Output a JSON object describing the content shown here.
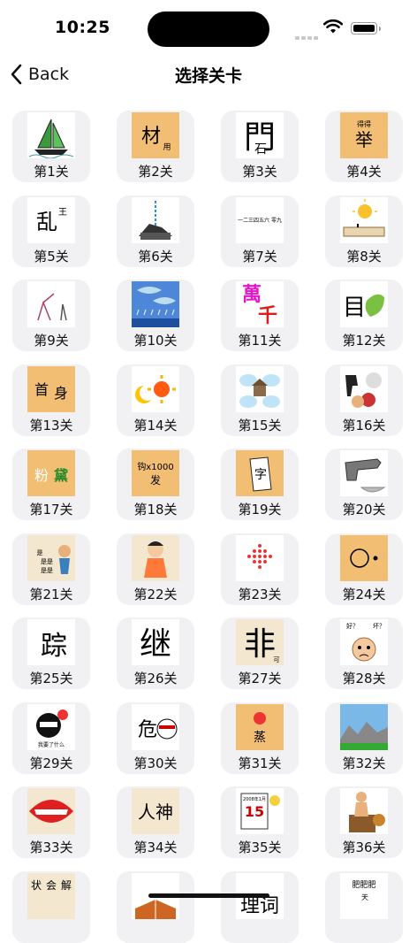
{
  "status_bar": {
    "time": "10:25"
  },
  "nav": {
    "back_label": "Back",
    "title": "选择关卡"
  },
  "levels": [
    {
      "label": "第1关",
      "icon": "sailboat-icon"
    },
    {
      "label": "第2关",
      "icon": "character-puzzle-icon",
      "chars": "材 用"
    },
    {
      "label": "第3关",
      "icon": "character-puzzle-icon",
      "chars": "門 石"
    },
    {
      "label": "第4关",
      "icon": "character-puzzle-icon",
      "chars": "得得 举"
    },
    {
      "label": "第5关",
      "icon": "character-puzzle-icon",
      "chars": "乱 王"
    },
    {
      "label": "第6关",
      "icon": "character-puzzle-icon"
    },
    {
      "label": "第7关",
      "icon": "character-puzzle-icon",
      "chars": "一二三四五六 零九"
    },
    {
      "label": "第8关",
      "icon": "sun-ruler-icon"
    },
    {
      "label": "第9关",
      "icon": "sketch-figures-icon"
    },
    {
      "label": "第10关",
      "icon": "fish-rain-icon"
    },
    {
      "label": "第11关",
      "icon": "character-puzzle-icon",
      "chars": "萬 千"
    },
    {
      "label": "第12关",
      "icon": "character-puzzle-icon",
      "chars": "目"
    },
    {
      "label": "第13关",
      "icon": "character-puzzle-icon",
      "chars": "首 身"
    },
    {
      "label": "第14关",
      "icon": "sun-moon-icon"
    },
    {
      "label": "第15关",
      "icon": "house-clouds-icon"
    },
    {
      "label": "第16关",
      "icon": "character-puzzle-icon"
    },
    {
      "label": "第17关",
      "icon": "character-puzzle-icon",
      "chars": "粉 黛"
    },
    {
      "label": "第18关",
      "icon": "character-puzzle-icon",
      "chars": "钩x1000 发"
    },
    {
      "label": "第19关",
      "icon": "character-puzzle-icon",
      "chars": "字"
    },
    {
      "label": "第20关",
      "icon": "revolver-bowl-icon"
    },
    {
      "label": "第21关",
      "icon": "character-puzzle-icon",
      "chars": "是 是是 是是 是是是"
    },
    {
      "label": "第22关",
      "icon": "cartoon-character-icon"
    },
    {
      "label": "第23关",
      "icon": "character-puzzle-icon"
    },
    {
      "label": "第24关",
      "icon": "circle-dot-icon"
    },
    {
      "label": "第25关",
      "icon": "character-puzzle-icon",
      "chars": "踪"
    },
    {
      "label": "第26关",
      "icon": "character-puzzle-icon",
      "chars": "继"
    },
    {
      "label": "第27关",
      "icon": "character-puzzle-icon",
      "chars": "非 可"
    },
    {
      "label": "第28关",
      "icon": "character-puzzle-icon",
      "chars": "好？ 坏？"
    },
    {
      "label": "第29关",
      "icon": "character-puzzle-icon",
      "chars": "我要了什么"
    },
    {
      "label": "第30关",
      "icon": "character-puzzle-icon",
      "chars": "危"
    },
    {
      "label": "第31关",
      "icon": "character-puzzle-icon",
      "chars": "蒸"
    },
    {
      "label": "第32关",
      "icon": "landscape-icon"
    },
    {
      "label": "第33关",
      "icon": "mouth-icon"
    },
    {
      "label": "第34关",
      "icon": "character-puzzle-icon",
      "chars": "人神"
    },
    {
      "label": "第35关",
      "icon": "calendar-icon",
      "chars": "2008年1月 15 星期日"
    },
    {
      "label": "第36关",
      "icon": "character-puzzle-icon"
    },
    {
      "label": "",
      "icon": "character-puzzle-icon",
      "chars": "状 会 解"
    },
    {
      "label": "",
      "icon": "book-icon"
    },
    {
      "label": "",
      "icon": "character-puzzle-icon",
      "chars": "理词"
    },
    {
      "label": "",
      "icon": "character-puzzle-icon",
      "chars": "肥肥肥 天"
    }
  ]
}
